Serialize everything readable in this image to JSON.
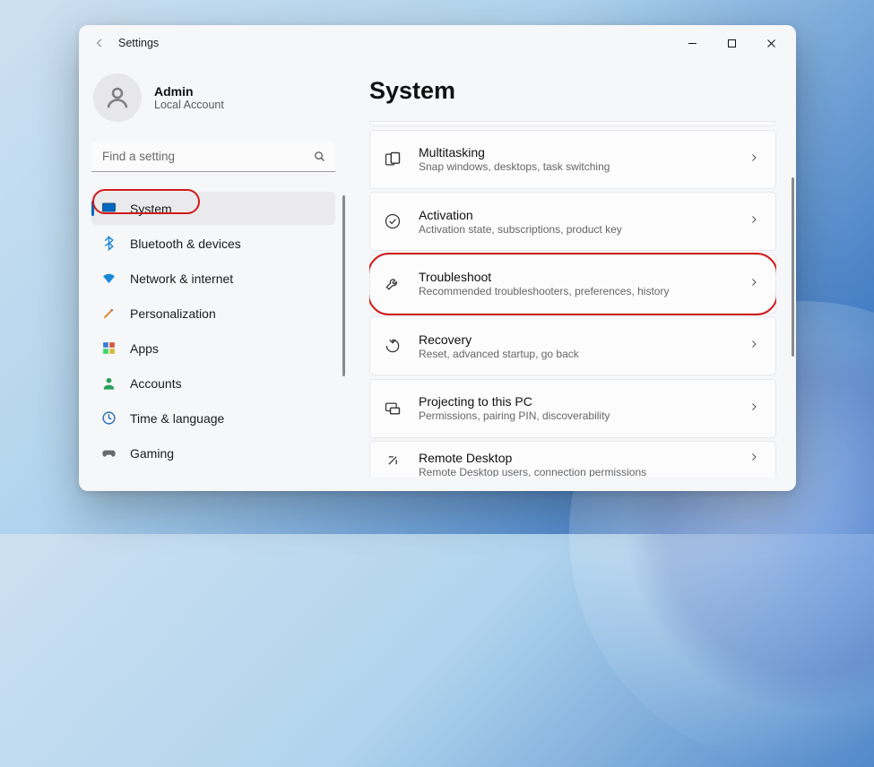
{
  "window": {
    "title": "Settings"
  },
  "profile": {
    "name": "Admin",
    "sub": "Local Account"
  },
  "search": {
    "placeholder": "Find a setting"
  },
  "sidebar": {
    "items": [
      {
        "id": "system",
        "label": "System",
        "active": true,
        "annot": true
      },
      {
        "id": "bluetooth",
        "label": "Bluetooth & devices"
      },
      {
        "id": "network",
        "label": "Network & internet"
      },
      {
        "id": "personalization",
        "label": "Personalization"
      },
      {
        "id": "apps",
        "label": "Apps"
      },
      {
        "id": "accounts",
        "label": "Accounts"
      },
      {
        "id": "time",
        "label": "Time & language"
      },
      {
        "id": "gaming",
        "label": "Gaming"
      }
    ]
  },
  "page": {
    "heading": "System"
  },
  "cards": [
    {
      "id": "multitasking",
      "title": "Multitasking",
      "sub": "Snap windows, desktops, task switching"
    },
    {
      "id": "activation",
      "title": "Activation",
      "sub": "Activation state, subscriptions, product key"
    },
    {
      "id": "troubleshoot",
      "title": "Troubleshoot",
      "sub": "Recommended troubleshooters, preferences, history",
      "annot": true
    },
    {
      "id": "recovery",
      "title": "Recovery",
      "sub": "Reset, advanced startup, go back"
    },
    {
      "id": "projecting",
      "title": "Projecting to this PC",
      "sub": "Permissions, pairing PIN, discoverability"
    },
    {
      "id": "remote",
      "title": "Remote Desktop",
      "sub": "Remote Desktop users, connection permissions",
      "cut": true
    }
  ]
}
